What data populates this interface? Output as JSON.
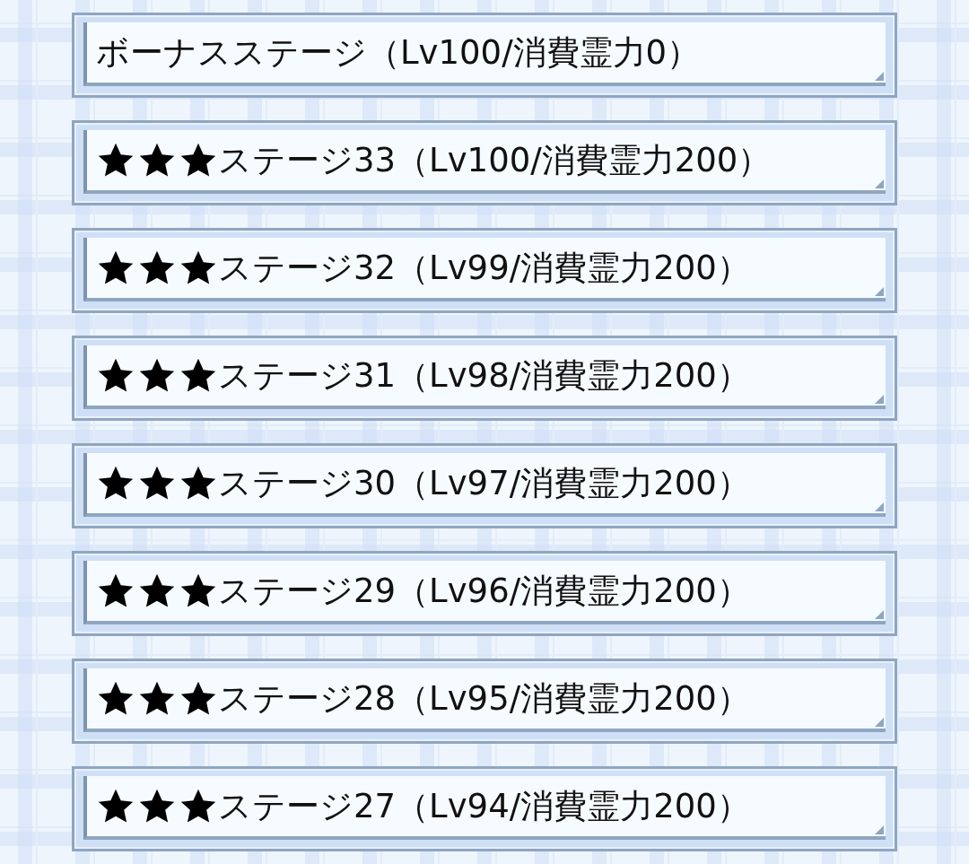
{
  "stages": [
    {
      "label": "ボーナスステージ（Lv100/消費霊力0）"
    },
    {
      "label": "ステージ33（Lv100/消費霊力200）",
      "stars": 3
    },
    {
      "label": "ステージ32（Lv99/消費霊力200）",
      "stars": 3
    },
    {
      "label": "ステージ31（Lv98/消費霊力200）",
      "stars": 3
    },
    {
      "label": "ステージ30（Lv97/消費霊力200）",
      "stars": 3
    },
    {
      "label": "ステージ29（Lv96/消費霊力200）",
      "stars": 3
    },
    {
      "label": "ステージ28（Lv95/消費霊力200）",
      "stars": 3
    },
    {
      "label": "ステージ27（Lv94/消費霊力200）",
      "stars": 3
    }
  ]
}
